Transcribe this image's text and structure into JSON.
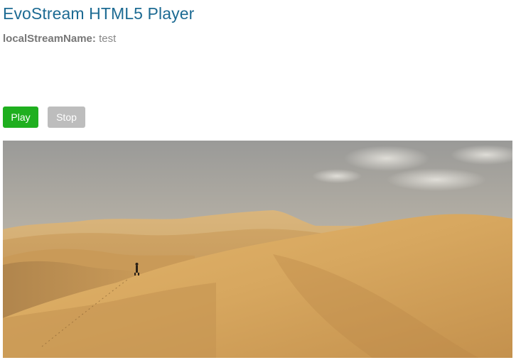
{
  "header": {
    "title": "EvoStream HTML5 Player"
  },
  "stream": {
    "label": "localStreamName:",
    "value": "test"
  },
  "controls": {
    "play_label": "Play",
    "stop_label": "Stop"
  },
  "colors": {
    "title": "#1d6b93",
    "play_button": "#1faf1f",
    "stop_button": "#bdbdbd"
  }
}
